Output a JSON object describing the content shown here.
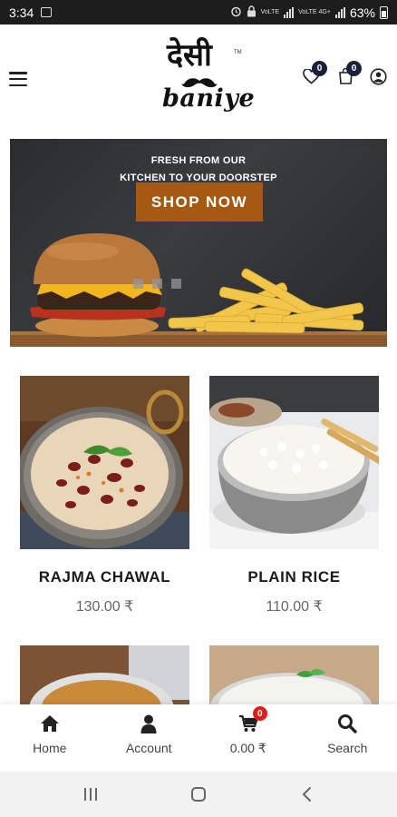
{
  "status_bar": {
    "time": "3:34",
    "network_label_1": "VoLTE",
    "network_label_2": "VoLTE 4G+",
    "battery": "63%"
  },
  "header": {
    "logo": {
      "hindi": "देसी",
      "english": "baniye",
      "tm": "TM"
    },
    "wishlist_count": "0",
    "cart_count": "0"
  },
  "banner": {
    "line1": "FRESH FROM OUR",
    "line2": "KITCHEN TO YOUR DOORSTEP",
    "cta_label": "SHOP NOW"
  },
  "products": [
    {
      "name": "RAJMA CHAWAL",
      "price": "130.00 ₹"
    },
    {
      "name": "PLAIN RICE",
      "price": "110.00 ₹"
    }
  ],
  "bottom_nav": {
    "home": "Home",
    "account": "Account",
    "cart_total": "0.00 ₹",
    "cart_badge": "0",
    "search": "Search"
  },
  "colors": {
    "cta_button": "#a55a14",
    "badge_dark": "#1a1f3a",
    "badge_red": "#e41b1b"
  }
}
